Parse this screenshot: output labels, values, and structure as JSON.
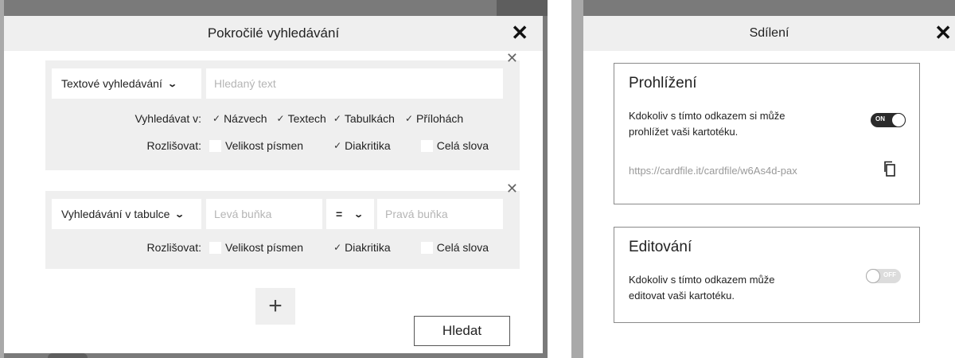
{
  "advanced_search": {
    "title": "Pokročilé vyhledávání",
    "close_icon": "close-icon",
    "text_block": {
      "mode_select": "Textové vyhledávání",
      "search_placeholder": "Hledaný text",
      "search_in_label": "Vyhledávat v:",
      "search_in_options": [
        {
          "label": "Názvech",
          "checked": true
        },
        {
          "label": "Textech",
          "checked": true
        },
        {
          "label": "Tabulkách",
          "checked": true
        },
        {
          "label": "Přílohách",
          "checked": true
        }
      ],
      "distinguish_label": "Rozlišovat:",
      "distinguish_options": [
        {
          "label": "Velikost písmen",
          "checked": false
        },
        {
          "label": "Diakritika",
          "checked": true
        },
        {
          "label": "Celá slova",
          "checked": false
        }
      ]
    },
    "table_block": {
      "mode_select": "Vyhledávání v tabulce",
      "left_cell_placeholder": "Levá buňka",
      "operator": "=",
      "right_cell_placeholder": "Pravá buňka",
      "distinguish_label": "Rozlišovat:",
      "distinguish_options": [
        {
          "label": "Velikost písmen",
          "checked": false
        },
        {
          "label": "Diakritika",
          "checked": true
        },
        {
          "label": "Celá slova",
          "checked": false
        }
      ]
    },
    "add_label": "+",
    "search_button": "Hledat"
  },
  "share": {
    "title": "Sdílení",
    "view": {
      "title": "Prohlížení",
      "description": "Kdokoliv s tímto odkazem si může prohlížet vaši kartotéku.",
      "toggle_label": "ON",
      "toggle_on": true,
      "link": "https://cardfile.it/cardfile/w6As4d-pax"
    },
    "edit": {
      "title": "Editování",
      "description": "Kdokoliv s tímto odkazem může editovat vaši kartotéku.",
      "toggle_label": "OFF",
      "toggle_on": false
    }
  },
  "colors": {
    "backdrop": "#7a7a7a",
    "panel": "#efefef",
    "toggle_on": "#2b2b2b"
  }
}
